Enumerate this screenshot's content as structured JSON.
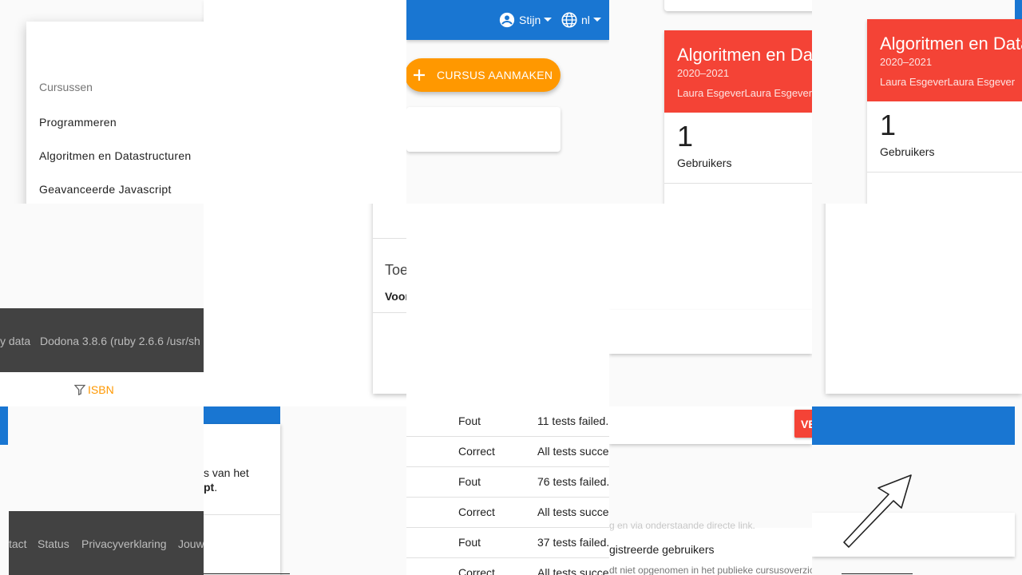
{
  "dropdown": {
    "header": "Cursussen",
    "items": [
      "Programmeren",
      "Algoritmen en Datastructuren",
      "Geavanceerde Javascript"
    ]
  },
  "navbar": {
    "user_label": "Stijn",
    "lang_label": "nl"
  },
  "actions": {
    "create_course_label": "CURSUS AANMAKEN"
  },
  "course_card": {
    "title": "Algoritmen en Datastructuren",
    "year": "2020–2021",
    "teachers": "Laura EsgeverLaura Esgever",
    "users_count": "1",
    "users_label": "Gebruikers"
  },
  "section": {
    "heading_partial": "Toe",
    "bold_partial": "Voor"
  },
  "footer": {
    "data_partial": "y data",
    "version_partial": "Dodona 3.8.6 (ruby 2.6.6 /usr/sh",
    "links": [
      "tact",
      "Status",
      "Privacyverklaring",
      "Jouw"
    ]
  },
  "filter": {
    "label": "ISBN"
  },
  "text_snippet": {
    "line1": "s van het",
    "line2": "pt"
  },
  "submissions": [
    {
      "status": "Fout",
      "summary": "11 tests failed.",
      "color": "#212121"
    },
    {
      "status": "Correct",
      "summary": "All tests succee",
      "color": "#212121"
    },
    {
      "status": "Fout",
      "summary": "76 tests failed.",
      "color": "#212121"
    },
    {
      "status": "Correct",
      "summary": "All tests succee",
      "color": "#212121"
    },
    {
      "status": "Fout",
      "summary": "37 tests failed.",
      "color": "#212121"
    },
    {
      "status": "Correct",
      "summary": "All tests succee",
      "color": "#212121"
    }
  ],
  "settings": {
    "button_partial": "VE",
    "faded_line": "g en via onderstaande directe link.",
    "option_label": "gistreerde gebruikers",
    "option_note": "dt niet opgenomen in het publieke cursusoverzic"
  },
  "colors": {
    "primary": "#1976d2",
    "accent": "#ff9800",
    "danger": "#f44336",
    "footer": "#424242"
  }
}
